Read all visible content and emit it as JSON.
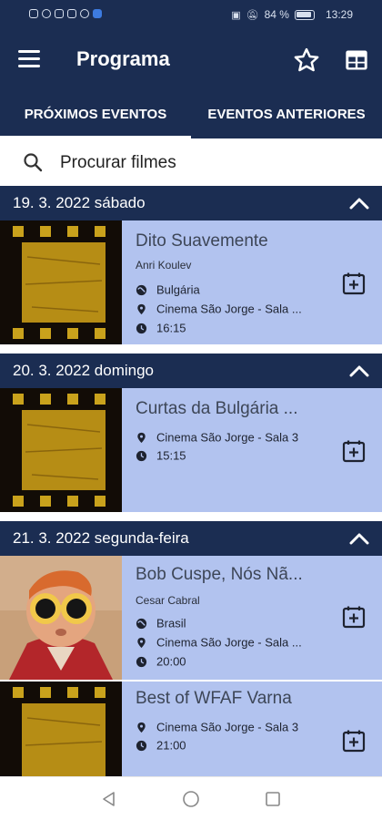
{
  "status_bar": {
    "battery": "84 %",
    "time": "13:29"
  },
  "app_bar": {
    "title": "Programa"
  },
  "tabs": [
    {
      "label": "PRÓXIMOS EVENTOS",
      "active": true
    },
    {
      "label": "EVENTOS ANTERIORES",
      "active": false
    }
  ],
  "search": {
    "placeholder": "Procurar filmes"
  },
  "days": [
    {
      "date": "19. 3. 2022 sábado",
      "events": [
        {
          "title": "Dito Suavemente",
          "director": "Anri Koulev",
          "country": "Bulgária",
          "venue": "Cinema São Jorge - Sala ...",
          "time": "16:15",
          "thumb": "film-strip"
        }
      ]
    },
    {
      "date": "20. 3. 2022 domingo",
      "events": [
        {
          "title": "Curtas da Bulgária ...",
          "venue": "Cinema São Jorge - Sala 3",
          "time": "15:15",
          "thumb": "film-strip"
        }
      ]
    },
    {
      "date": "21. 3. 2022 segunda-feira",
      "events": [
        {
          "title": "Bob Cuspe, Nós Nã...",
          "director": "Cesar Cabral",
          "country": "Brasil",
          "venue": "Cinema São Jorge - Sala ...",
          "time": "20:00",
          "thumb": "puppet"
        },
        {
          "title": "Best of WFAF Varna",
          "venue": "Cinema São Jorge - Sala 3",
          "time": "21:00",
          "thumb": "film-strip"
        }
      ]
    }
  ],
  "colors": {
    "primary": "#1b2d52",
    "card": "#b2c3ef"
  }
}
